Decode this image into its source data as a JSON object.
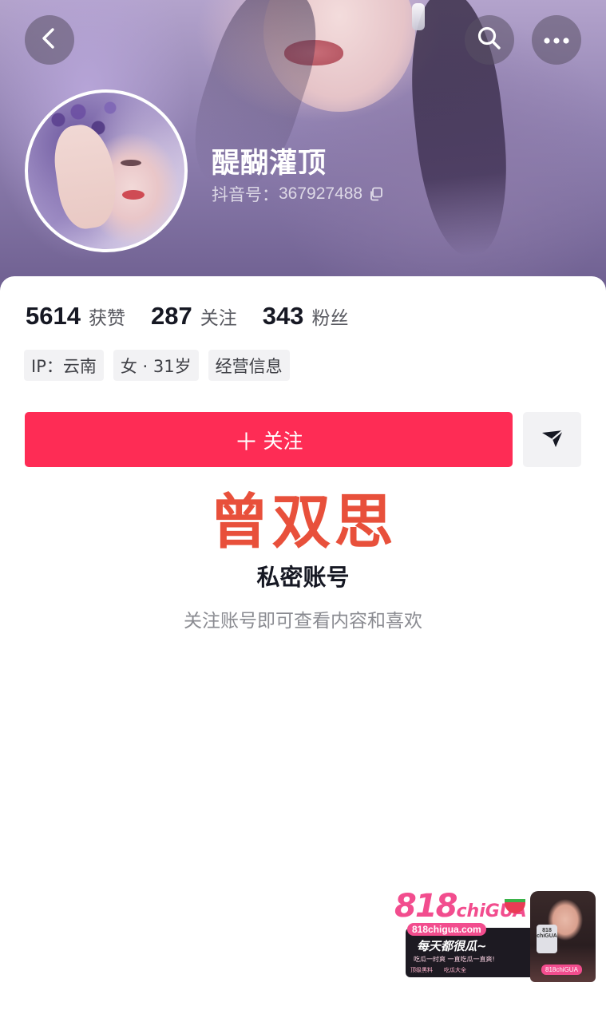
{
  "header": {
    "nickname": "醍醐灌顶",
    "douyin_id_label": "抖音号：",
    "douyin_id_value": "367927488",
    "icons": [
      "back-icon",
      "search-icon",
      "more-icon",
      "copy-icon"
    ]
  },
  "stats": [
    {
      "value": "5614",
      "label": "获赞"
    },
    {
      "value": "287",
      "label": "关注"
    },
    {
      "value": "343",
      "label": "粉丝"
    }
  ],
  "tags": [
    "IP：云南",
    "女 · 31岁",
    "经营信息"
  ],
  "actions": {
    "follow_plus": "＋",
    "follow_label": "关注",
    "share_icon": "send-icon"
  },
  "overlay_name": "曾双思",
  "private": {
    "title": "私密账号",
    "subtitle": "关注账号即可查看内容和喜欢"
  },
  "watermark": {
    "logo_main": "818",
    "logo_small": "chiGUA",
    "url": "818chigua.com",
    "slogan": "每天都很瓜~",
    "sub": "吃瓜一时爽 一直吃瓜一直爽!",
    "row_left": "顶级黑料",
    "row_right": "吃瓜大全",
    "badge": "818 chiGUA",
    "tag": "818chiGUA"
  },
  "colors": {
    "accent": "#fe2c55",
    "overlay_text": "#e8503b",
    "watermark_pink": "#f24d8e"
  }
}
